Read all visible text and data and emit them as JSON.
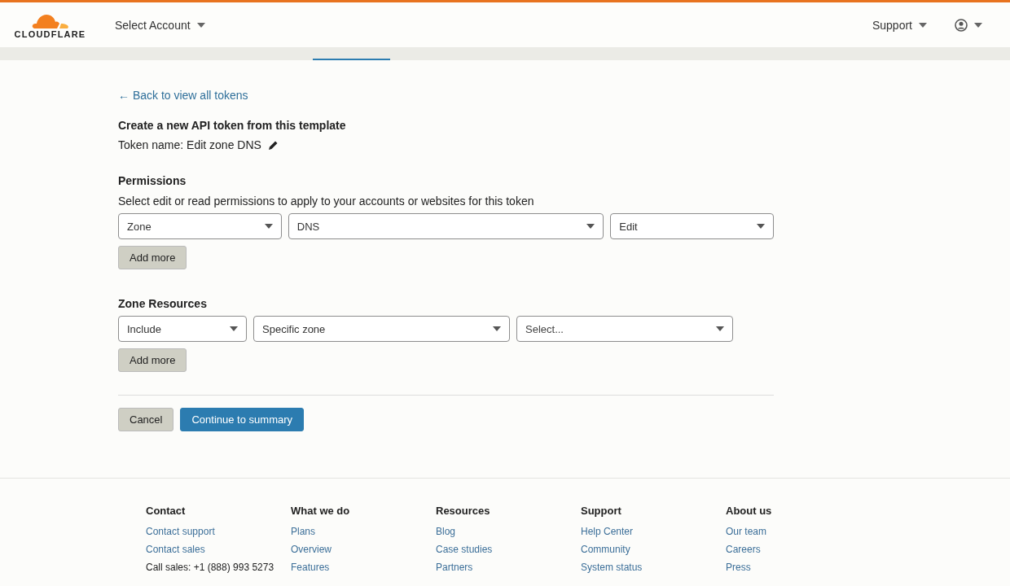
{
  "header": {
    "logo": "CLOUDFLARE",
    "account_menu": "Select Account",
    "support_menu": "Support"
  },
  "back_link": "← Back to view all tokens",
  "title": "Create a new API token from this template",
  "token_name": "Token name: Edit zone DNS",
  "permissions": {
    "heading": "Permissions",
    "description": "Select edit or read permissions to apply to your accounts or websites for this token",
    "selects": [
      {
        "value": "Zone"
      },
      {
        "value": "DNS"
      },
      {
        "value": "Edit"
      }
    ],
    "add_button": "Add more"
  },
  "zone_resources": {
    "heading": "Zone Resources",
    "selects": [
      {
        "value": "Include"
      },
      {
        "value": "Specific zone"
      },
      {
        "placeholder": "Select..."
      }
    ],
    "add_button": "Add more"
  },
  "actions": [
    {
      "label": "Cancel",
      "kind": "secondary"
    },
    {
      "label": "Continue to summary",
      "kind": "primary"
    }
  ],
  "footer": [
    {
      "heading": "Contact",
      "items": [
        {
          "label": "Contact support",
          "kind": "link"
        },
        {
          "label": "Contact sales",
          "kind": "link"
        },
        {
          "label": "Call sales: +1 (888) 993 5273",
          "kind": "text"
        }
      ]
    },
    {
      "heading": "What we do",
      "items": [
        {
          "label": "Plans",
          "kind": "link"
        },
        {
          "label": "Overview",
          "kind": "link"
        },
        {
          "label": "Features",
          "kind": "link"
        }
      ]
    },
    {
      "heading": "Resources",
      "items": [
        {
          "label": "Blog",
          "kind": "link"
        },
        {
          "label": "Case studies",
          "kind": "link"
        },
        {
          "label": "Partners",
          "kind": "link"
        }
      ]
    },
    {
      "heading": "Support",
      "items": [
        {
          "label": "Help Center",
          "kind": "link"
        },
        {
          "label": "Community",
          "kind": "link"
        },
        {
          "label": "System status",
          "kind": "link"
        }
      ]
    },
    {
      "heading": "About us",
      "items": [
        {
          "label": "Our team",
          "kind": "link"
        },
        {
          "label": "Careers",
          "kind": "link"
        },
        {
          "label": "Press",
          "kind": "link"
        }
      ]
    }
  ]
}
